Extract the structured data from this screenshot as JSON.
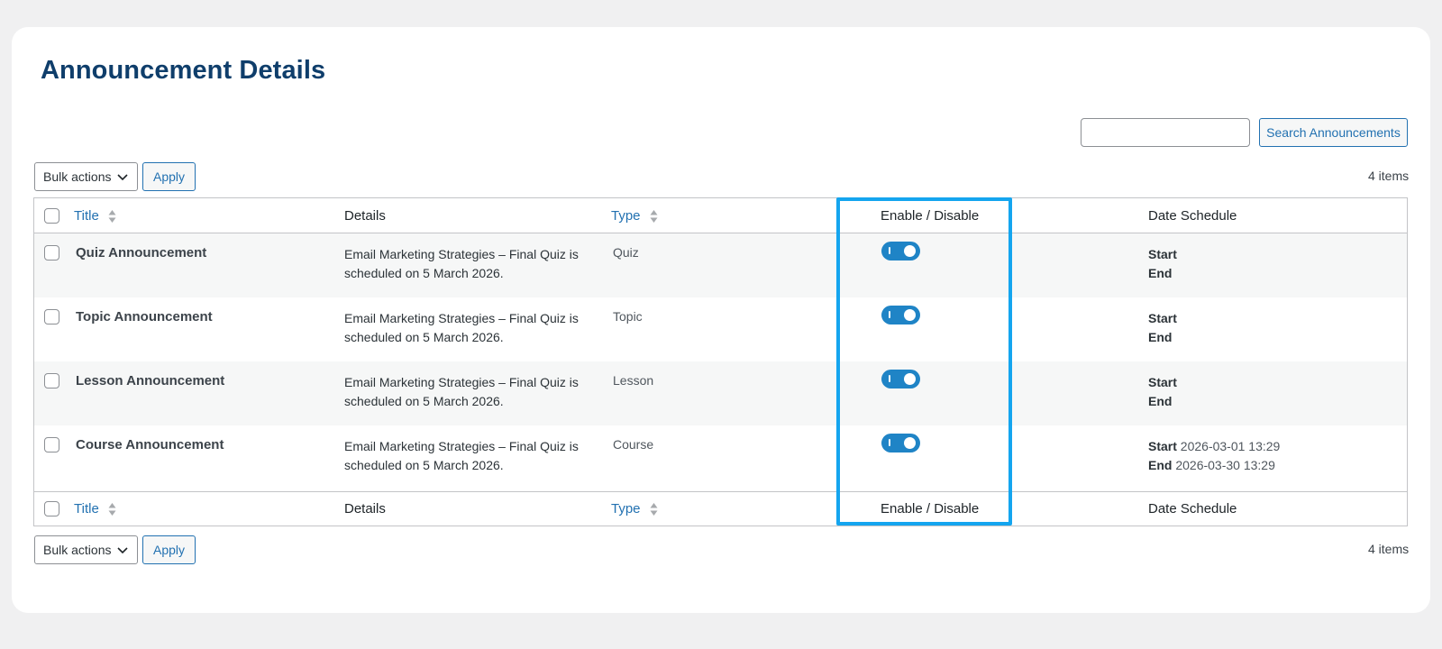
{
  "page": {
    "title": "Announcement Details",
    "accent_color": "#2271b1",
    "highlight_color": "#14a5ef"
  },
  "search": {
    "value": "",
    "placeholder": "",
    "button_label": "Search Announcements"
  },
  "top_nav": {
    "bulk_label": "Bulk actions",
    "apply_label": "Apply",
    "items_count": "4 items"
  },
  "bottom_nav": {
    "bulk_label": "Bulk actions",
    "apply_label": "Apply",
    "items_count": "4 items"
  },
  "columns": {
    "title": "Title",
    "details": "Details",
    "type": "Type",
    "enable": "Enable / Disable",
    "date": "Date Schedule"
  },
  "rows": [
    {
      "title": "Quiz Announcement",
      "details": "Email Marketing Strategies – Final Quiz is scheduled on 5 March 2026.",
      "type": "Quiz",
      "enabled": true,
      "start_label": "Start",
      "start_value": "",
      "end_label": "End",
      "end_value": ""
    },
    {
      "title": "Topic Announcement",
      "details": "Email Marketing Strategies – Final Quiz is scheduled on 5 March 2026.",
      "type": "Topic",
      "enabled": true,
      "start_label": "Start",
      "start_value": "",
      "end_label": "End",
      "end_value": ""
    },
    {
      "title": "Lesson Announcement",
      "details": "Email Marketing Strategies – Final Quiz is scheduled on 5 March 2026.",
      "type": "Lesson",
      "enabled": true,
      "start_label": "Start",
      "start_value": "",
      "end_label": "End",
      "end_value": ""
    },
    {
      "title": "Course Announcement",
      "details": "Email Marketing Strategies – Final Quiz is scheduled on 5 March 2026.",
      "type": "Course",
      "enabled": true,
      "start_label": "Start",
      "start_value": "2026-03-01 13:29",
      "end_label": "End",
      "end_value": "2026-03-30 13:29"
    }
  ]
}
